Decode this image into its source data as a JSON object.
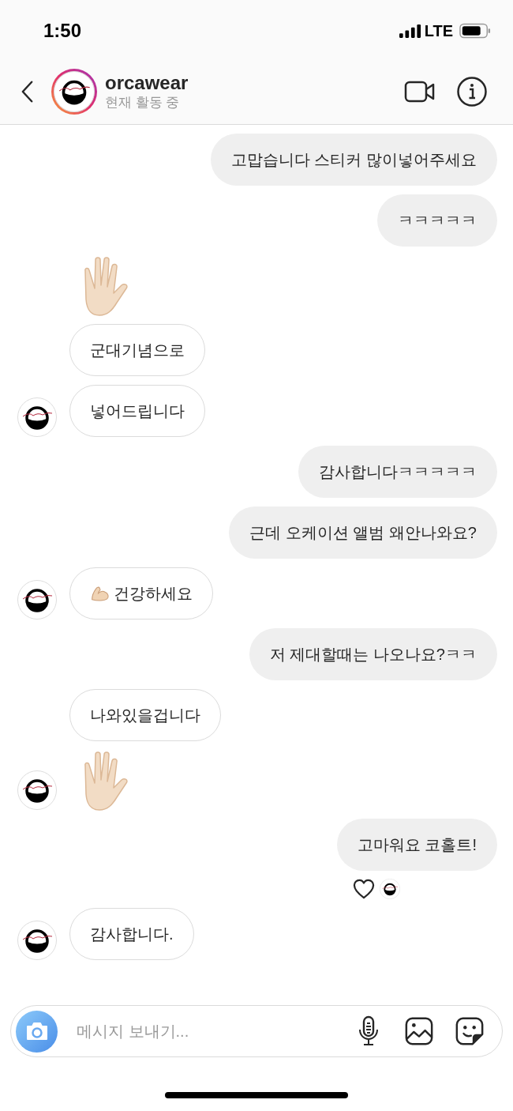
{
  "status_bar": {
    "time": "1:50",
    "network": "LTE"
  },
  "header": {
    "username": "orcawear",
    "status": "현재 활동 중"
  },
  "messages": [
    {
      "kind": "sent",
      "text": "고맙습니다 스티커 많이넣어주세요",
      "liked": false
    },
    {
      "kind": "sent",
      "text": "ㅋㅋㅋㅋㅋ",
      "liked": false
    },
    {
      "kind": "sticker",
      "avatar": false
    },
    {
      "kind": "received",
      "text": "군대기념으로",
      "avatar": false,
      "has_emoji": false
    },
    {
      "kind": "received",
      "text": "넣어드립니다",
      "avatar": true,
      "has_emoji": false
    },
    {
      "kind": "sent",
      "text": "감사합니다ㅋㅋㅋㅋㅋ",
      "liked": false
    },
    {
      "kind": "sent",
      "text": "근데 오케이션 앨범 왜안나와요?",
      "liked": false
    },
    {
      "kind": "received",
      "text": "건강하세요",
      "avatar": true,
      "has_emoji": true
    },
    {
      "kind": "sent",
      "text": "저 제대할때는 나오나요?ㅋㅋ",
      "liked": false
    },
    {
      "kind": "received",
      "text": "나와있을겁니다",
      "avatar": false,
      "has_emoji": false
    },
    {
      "kind": "sticker",
      "avatar": true
    },
    {
      "kind": "sent",
      "text": "고마워요 코홀트!",
      "liked": true
    },
    {
      "kind": "received",
      "text": "감사합니다.",
      "avatar": true,
      "has_emoji": false
    }
  ],
  "composer": {
    "placeholder": "메시지 보내기..."
  }
}
